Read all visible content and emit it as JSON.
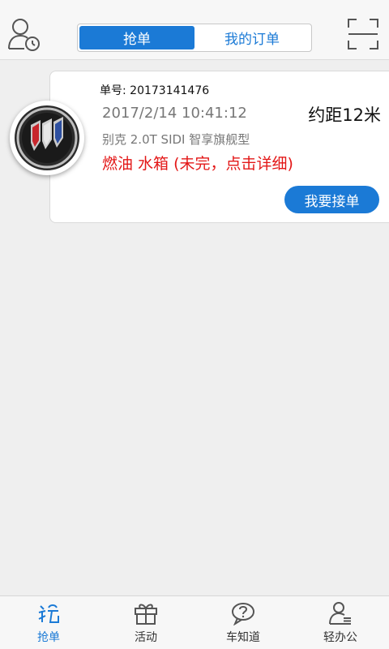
{
  "header": {
    "user_icon": "user-location-icon",
    "scan_icon": "scan-icon",
    "tabs": [
      {
        "label": "抢单",
        "active": true
      },
      {
        "label": "我的订单",
        "active": false
      }
    ]
  },
  "order": {
    "number_label": "单号: 20173141476",
    "time": "2017/2/14 10:41:12",
    "distance": "约距12米",
    "car_model": "别克  2.0T SIDI 智享旗舰型",
    "items": "燃油  水箱  (未完，点击详细)",
    "accept_label": "我要接单",
    "brand_logo": "buick-logo"
  },
  "nav": {
    "items": [
      {
        "label": "抢单",
        "icon": "grab-order-icon",
        "active": true
      },
      {
        "label": "活动",
        "icon": "gift-icon",
        "active": false
      },
      {
        "label": "车知道",
        "icon": "question-bubble-icon",
        "active": false
      },
      {
        "label": "轻办公",
        "icon": "office-user-icon",
        "active": false
      }
    ]
  },
  "colors": {
    "accent": "#1b7ad6",
    "alert": "#e31717",
    "background": "#efefef"
  }
}
